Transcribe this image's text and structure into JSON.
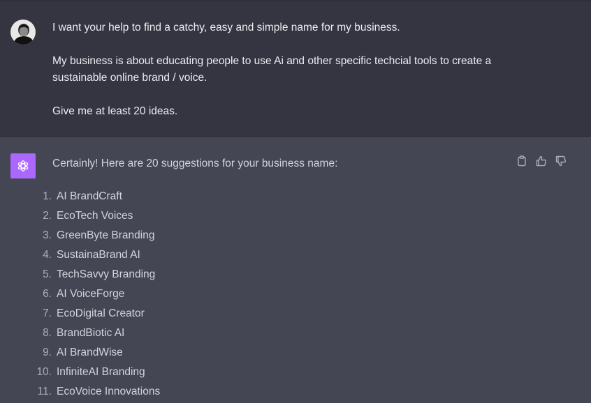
{
  "user_message": {
    "paragraphs": [
      "I want your help to find a catchy, easy and simple name for my business.",
      "My business is about educating people to use Ai and other specific techcial tools to create a sustainable online brand / voice.",
      "Give me at least 20 ideas."
    ]
  },
  "assistant_message": {
    "intro": "Certainly! Here are 20 suggestions for your business name:",
    "items": [
      {
        "num": "1.",
        "text": "AI BrandCraft"
      },
      {
        "num": "2.",
        "text": "EcoTech Voices"
      },
      {
        "num": "3.",
        "text": "GreenByte Branding"
      },
      {
        "num": "4.",
        "text": "SustainaBrand AI"
      },
      {
        "num": "5.",
        "text": "TechSavvy Branding"
      },
      {
        "num": "6.",
        "text": "AI VoiceForge"
      },
      {
        "num": "7.",
        "text": "EcoDigital Creator"
      },
      {
        "num": "8.",
        "text": "BrandBiotic AI"
      },
      {
        "num": "9.",
        "text": "AI BrandWise"
      },
      {
        "num": "10.",
        "text": "InfiniteAI Branding"
      },
      {
        "num": "11.",
        "text": "EcoVoice Innovations"
      }
    ]
  },
  "actions": [
    "copy-icon",
    "thumbs-up-icon",
    "thumbs-down-icon"
  ],
  "colors": {
    "user_bg": "#343541",
    "assistant_bg": "#444654",
    "gpt_avatar": "#ab68ff",
    "text": "#ececf1"
  }
}
